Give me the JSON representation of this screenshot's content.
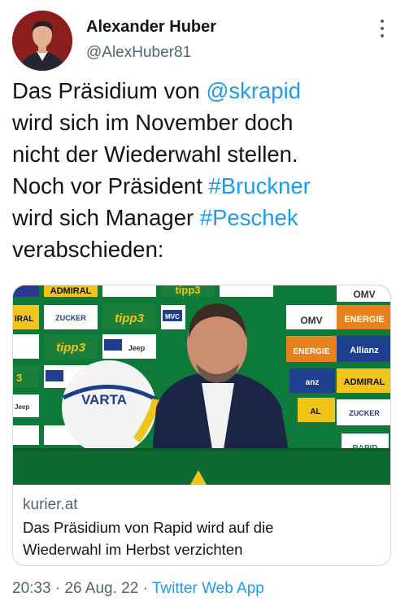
{
  "author": {
    "name": "Alexander Huber",
    "handle": "@AlexHuber81"
  },
  "tweet": {
    "line1_pre": "Das Präsidium von ",
    "line1_link": "@skrapid",
    "line2": "wird sich im November doch",
    "line3": "nicht der Wiederwahl stellen.",
    "line4_pre": "Noch vor Präsident ",
    "line4_link": "#Bruckner",
    "line5_pre": "wird sich Manager ",
    "line5_link": "#Peschek",
    "line6": "verabschieden:"
  },
  "card": {
    "domain": "kurier.at",
    "title_line1": "Das Präsidium von Rapid wird auf die",
    "title_line2": "Wiederwahl im Herbst verzichten",
    "image": {
      "sponsors": [
        "ADMIRAL",
        "ZUCKER",
        "tipp3",
        "MVC",
        "Jeep",
        "OMV",
        "WIEN ENERGIE",
        "Allianz",
        "VARTA",
        "RAPID"
      ]
    }
  },
  "meta": {
    "time": "20:33",
    "sep1": " · ",
    "date": "26 Aug. 22",
    "sep2": " · ",
    "source": "Twitter Web App"
  },
  "colors": {
    "link": "#1d9bf0",
    "secondary": "#536471",
    "text": "#0f1419",
    "border": "#cfd9de",
    "rapid_green": "#0e7a3a"
  }
}
